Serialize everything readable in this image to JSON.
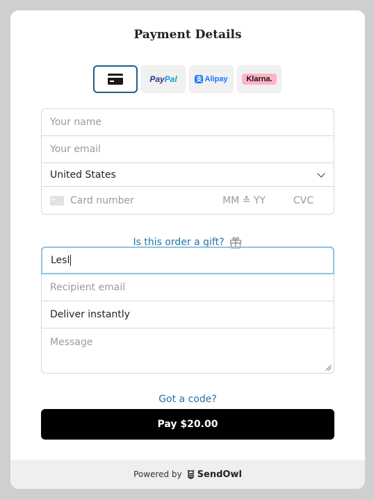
{
  "title": "Payment Details",
  "methods": [
    {
      "name": "card",
      "label": ""
    },
    {
      "name": "paypal",
      "label_a": "Pay",
      "label_b": "Pal"
    },
    {
      "name": "alipay",
      "label": "Alipay"
    },
    {
      "name": "klarna",
      "label": "Klarna."
    }
  ],
  "form": {
    "name_placeholder": "Your name",
    "email_placeholder": "Your email",
    "country_value": "United States",
    "card_placeholder": "Card number",
    "expiry_placeholder": "MM ≛ YY",
    "cvc_placeholder": "CVC"
  },
  "gift": {
    "link_label": "Is this order a gift?",
    "recipient_name_value": "Lesl",
    "recipient_email_placeholder": "Recipient email",
    "delivery_value": "Deliver instantly",
    "message_placeholder": "Message"
  },
  "code_link": "Got a code?",
  "pay_button": "Pay $20.00",
  "footer": {
    "powered_by": "Powered by",
    "brand": "SendOwl"
  },
  "colors": {
    "accent": "#2173a6",
    "active_border": "#8cc2e6",
    "button": "#000000"
  }
}
